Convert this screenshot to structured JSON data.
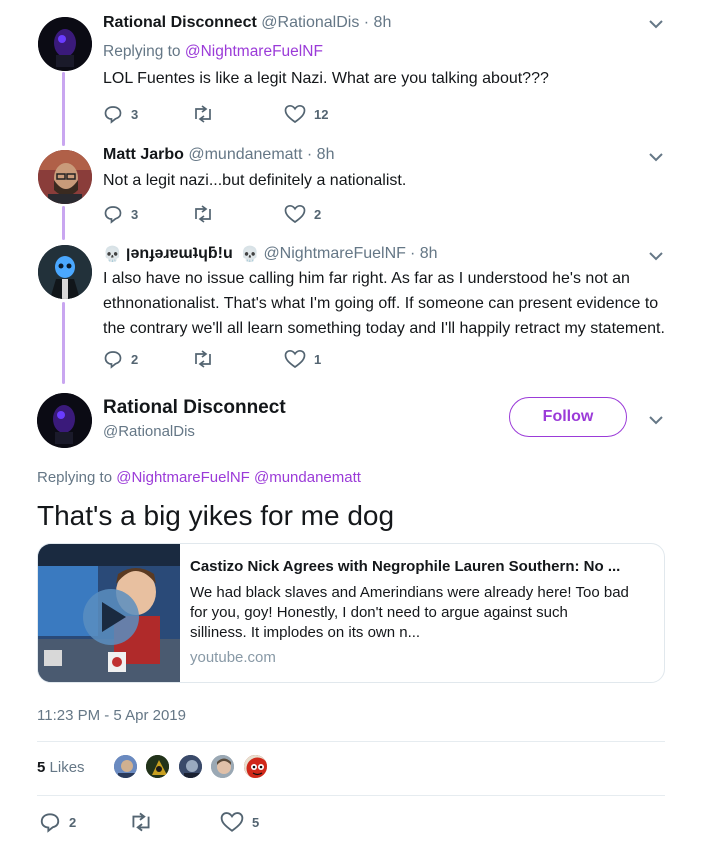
{
  "tweets": [
    {
      "name": "Rational Disconnect",
      "handle": "@RationalDis",
      "time": "· 8h",
      "replying_prefix": "Replying to",
      "replying_to": "@NightmareFuelNF",
      "text": "LOL Fuentes is like a legit Nazi. What are you talking about???",
      "replies": "3",
      "retweets": "",
      "likes": "12"
    },
    {
      "name": "Matt Jarbo",
      "handle": "@mundanematt",
      "time": "· 8h",
      "text": "Not a legit nazi...but definitely a nationalist.",
      "replies": "3",
      "retweets": "",
      "likes": "2"
    },
    {
      "name": "ןǝnɟǝɹɐɯʇɥƃ!u",
      "handle": "@NightmareFuelNF",
      "time": "· 8h",
      "text_lines": [
        "I also have no issue calling him far right. As far as I understood he's not an",
        "ethnonationalist. That's what I'm going off. If someone can present evidence to",
        "the contrary we'll all learn something today and I'll happily retract my statement."
      ],
      "replies": "2",
      "retweets": "",
      "likes": "1"
    }
  ],
  "main_tweet": {
    "name": "Rational Disconnect",
    "handle": "@RationalDis",
    "follow_label": "Follow",
    "replying_prefix": "Replying to",
    "replying_to_1": "@NightmareFuelNF",
    "replying_to_2": "@mundanematt",
    "text": "That's a big yikes for me dog",
    "card": {
      "title": "Castizo Nick Agrees with Negrophile Lauren Southern: No ...",
      "desc_lines": [
        "We had black slaves and Amerindians were already here! Too bad",
        "for you, goy! Honestly, I don't need to argue against such",
        "silliness. It implodes on its own n..."
      ],
      "domain": "youtube.com"
    },
    "timestamp": "11:23 PM - 5 Apr 2019",
    "likes_count": "5",
    "likes_label": "Likes",
    "replies": "2",
    "retweets": "",
    "likes": "5"
  },
  "colors": {
    "accent": "#9b3bd8",
    "thread_line": "#c9a6f0",
    "muted": "#657786"
  }
}
